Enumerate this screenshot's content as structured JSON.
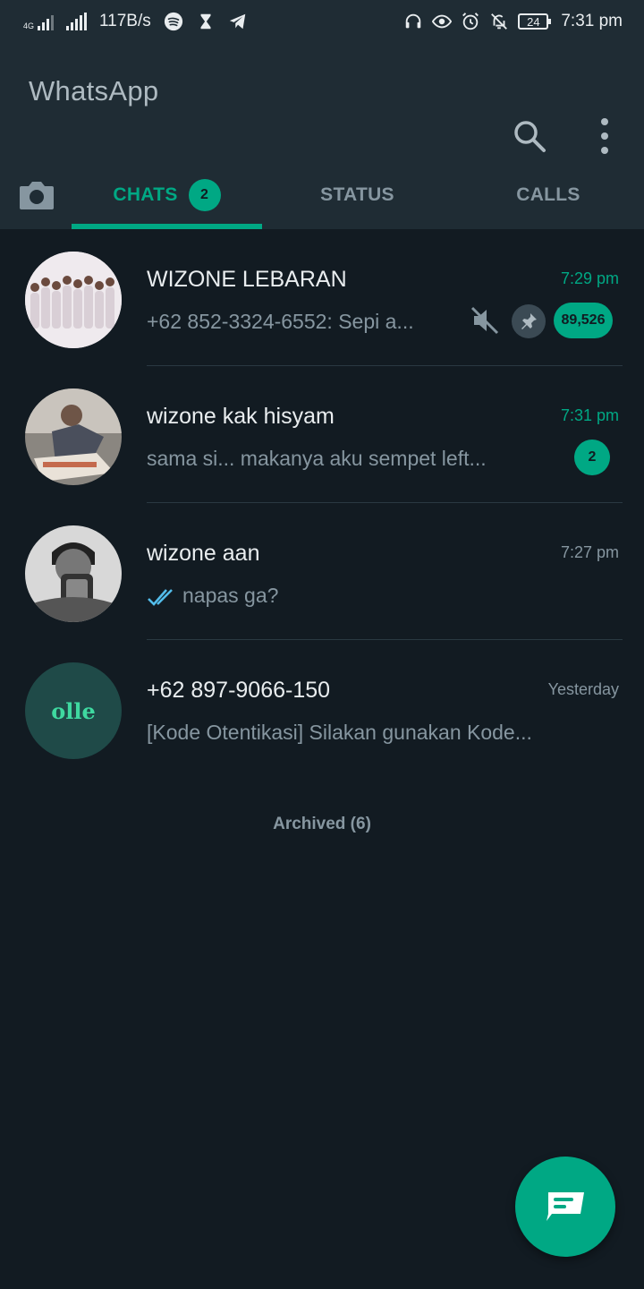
{
  "status_bar": {
    "network_tag": "4G",
    "speed": "117B/s",
    "battery": "24",
    "time": "7:31 pm",
    "icons": [
      "spotify-icon",
      "hourglass-icon",
      "telegram-icon",
      "headset-icon",
      "eye-icon",
      "alarm-icon",
      "notifications-off-icon"
    ]
  },
  "app_bar": {
    "title": "WhatsApp",
    "search_icon": "search-icon",
    "menu_icon": "more-vert-icon"
  },
  "tabs": [
    {
      "label": "CHATS",
      "badge": "2",
      "active": true
    },
    {
      "label": "STATUS"
    },
    {
      "label": "CALLS"
    }
  ],
  "chats": [
    {
      "name": "WIZONE LEBARAN",
      "time": "7:29 pm",
      "preview": "+62 852-3324-6552: Sepi a...",
      "unread": "89,526",
      "muted": true,
      "pinned": true
    },
    {
      "name": "wizone kak hisyam",
      "time": "7:31 pm",
      "preview": "sama si... makanya aku sempet left...",
      "unread": "2"
    },
    {
      "name": "wizone aan",
      "time": "7:27 pm",
      "preview": "napas ga?",
      "read_ticks": true
    },
    {
      "name": "+62 897-9066-150",
      "time": "Yesterday",
      "preview": "[Kode Otentikasi] Silakan gunakan Kode...",
      "avatar_text": "olle"
    }
  ],
  "archived_label": "Archived (6)",
  "colors": {
    "accent": "#00a884",
    "background": "#121b22",
    "header": "#1f2c34",
    "read_tick": "#53bdeb"
  },
  "fab_icon": "new-chat-icon"
}
